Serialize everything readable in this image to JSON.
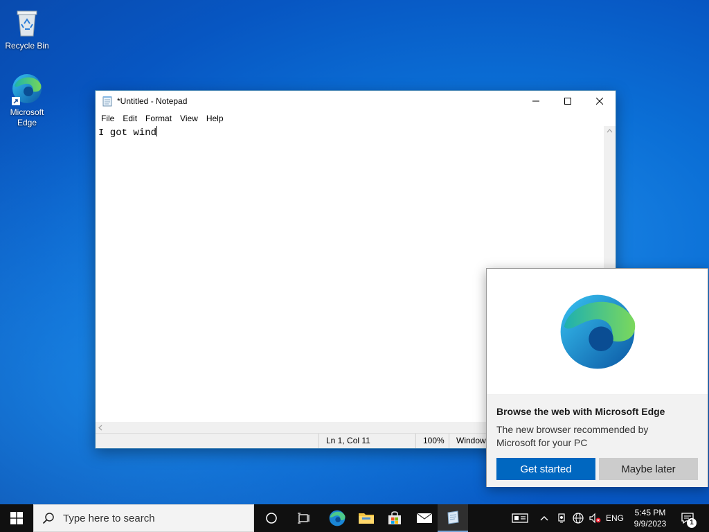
{
  "desktop": {
    "icons": [
      {
        "label": "Recycle Bin",
        "icon": "recycle-bin-icon"
      },
      {
        "label": "Microsoft Edge",
        "icon": "edge-icon"
      }
    ]
  },
  "notepad": {
    "title": "*Untitled - Notepad",
    "menu": [
      "File",
      "Edit",
      "Format",
      "View",
      "Help"
    ],
    "content": "I got wind",
    "status": {
      "position": "Ln 1, Col 11",
      "zoom": "100%",
      "line_ending": "Windows (CRLF)"
    }
  },
  "edge_popup": {
    "heading": "Browse the web with Microsoft Edge",
    "description": "The new browser recommended by Microsoft for your PC",
    "primary_button": "Get started",
    "secondary_button": "Maybe later",
    "primary_color": "#0067c0"
  },
  "taskbar": {
    "search_placeholder": "Type here to search",
    "pinned": [
      "task-view-icon",
      "edge-icon",
      "file-explorer-icon",
      "store-icon",
      "mail-icon",
      "notepad-icon"
    ],
    "tray": {
      "language": "ENG",
      "time": "5:45 PM",
      "date": "9/9/2023",
      "notification_count": "1"
    }
  }
}
